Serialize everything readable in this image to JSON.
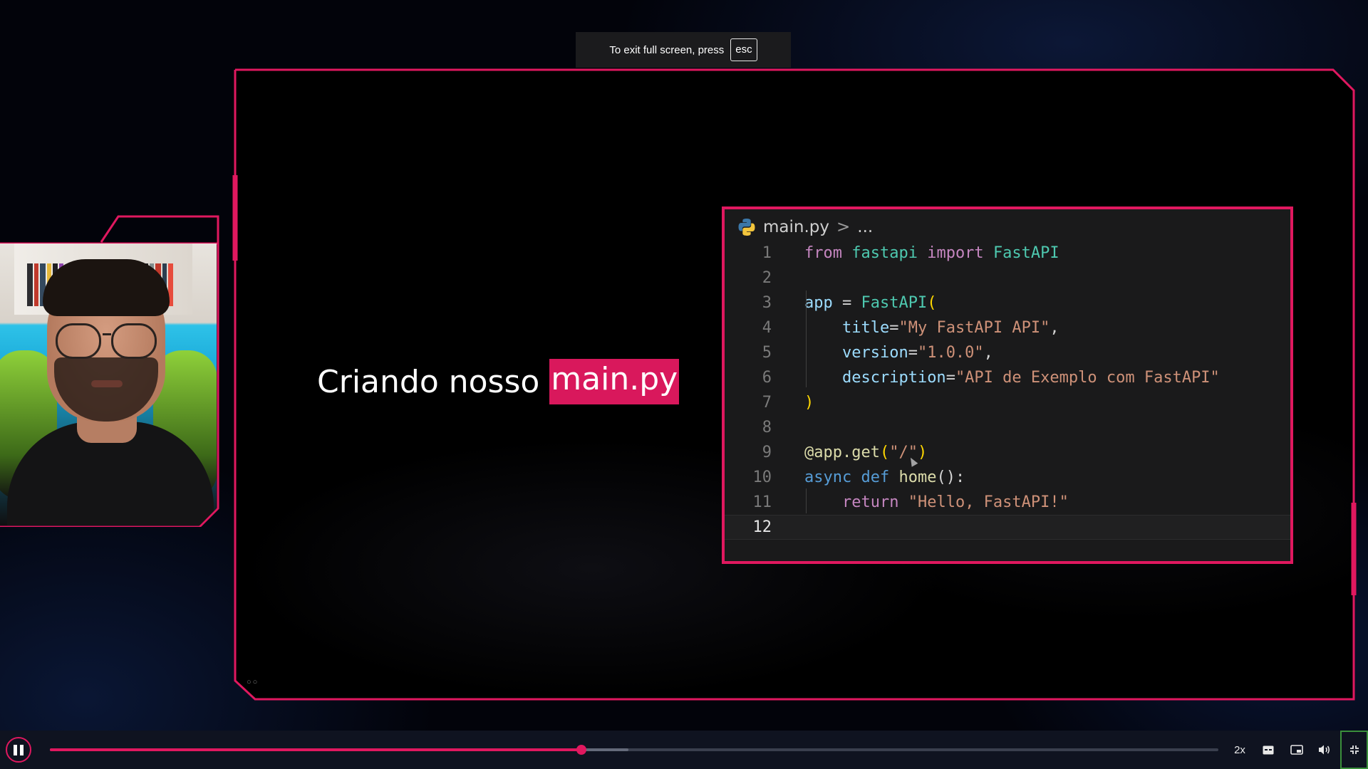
{
  "toast": {
    "text": "To exit full screen, press",
    "key": "esc"
  },
  "slide": {
    "title_plain": "Criando nosso",
    "title_highlight": "main.py"
  },
  "editor": {
    "file": "main.py",
    "breadcrumb_sep": ">",
    "breadcrumb_rest": "...",
    "current_line": 12,
    "lines": [
      {
        "n": "1"
      },
      {
        "n": "2"
      },
      {
        "n": "3"
      },
      {
        "n": "4"
      },
      {
        "n": "5"
      },
      {
        "n": "6"
      },
      {
        "n": "7"
      },
      {
        "n": "8"
      },
      {
        "n": "9"
      },
      {
        "n": "10"
      },
      {
        "n": "11"
      },
      {
        "n": "12"
      }
    ],
    "code": {
      "l1": [
        "from",
        "fastapi",
        "import",
        "FastAPI"
      ],
      "l3": [
        "app",
        "=",
        "FastAPI",
        "("
      ],
      "l4": [
        "title",
        "=",
        "\"My FastAPI API\"",
        ","
      ],
      "l5": [
        "version",
        "=",
        "\"1.0.0\"",
        ","
      ],
      "l6": [
        "description",
        "=",
        "\"API de Exemplo com FastAPI\""
      ],
      "l7": [
        ")"
      ],
      "l9": [
        "@app.get",
        "(",
        "\"/\"",
        ")"
      ],
      "l10": [
        "async",
        "def",
        "home",
        "():"
      ],
      "l11": [
        "return",
        "\"Hello, FastAPI!\""
      ]
    }
  },
  "player": {
    "progress": 0.455,
    "buffered": 0.495,
    "speed_label": "2x",
    "icons": [
      "pause-icon",
      "captions-icon",
      "picture-in-picture-icon",
      "volume-icon",
      "exit-fullscreen-icon"
    ]
  },
  "colors": {
    "accent": "#e0185f",
    "background": "#02030a",
    "editor_bg": "#1a1a1b"
  }
}
